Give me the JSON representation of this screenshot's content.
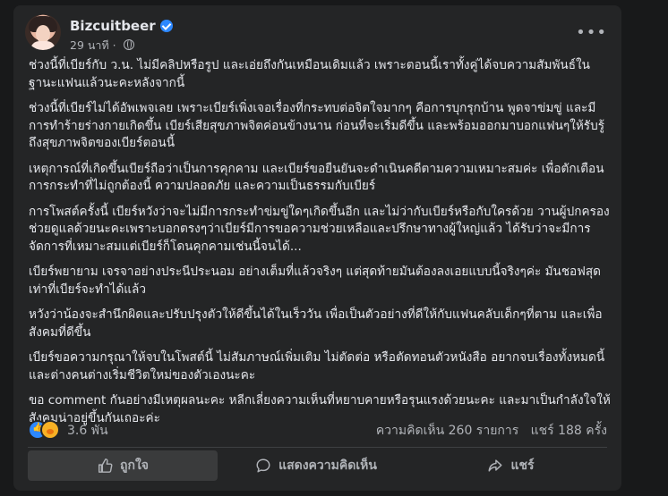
{
  "post": {
    "author": "Bizcuitbeer",
    "time": "29 นาที",
    "paragraphs": [
      "ช่วงนี้ที่เบียร์กับ ว.น. ไม่มีคลิปหรือรูป และเอ่ยถึงกันเหมือนเดิมแล้ว เพราะตอนนี้เราทั้งคู่ได้จบความสัมพันธ์ในฐานะแฟนแล้วนะคะหลังจากนี้",
      "ช่วงนี้ที่เบียร์ไม่ได้อัพเพจเลย เพราะเบียร์เพิ่งเจอเรื่องที่กระทบต่อจิตใจมากๆ คือการบุกรุกบ้าน พูดจาข่มขู่ และมีการทำร้ายร่างกายเกิดขึ้น เบียร์เสียสุขภาพจิตค่อนข้างนาน ก่อนที่จะเริ่มดีขึ้น และพร้อมออกมาบอกแฟนๆให้รับรู้ถึงสุขภาพจิตของเบียร์ตอนนี้",
      "เหตุการณ์ที่เกิดขึ้นเบียร์ถือว่าเป็นการคุกคาม และเบียร์ขอยืนยันจะดำเนินคดีตามความเหมาะสมค่ะ เพื่อตักเตือนการกระทำที่ไม่ถูกต้องนี้ ความปลอดภัย และความเป็นธรรมกับเบียร์",
      "การโพสต์ครั้งนี้ เบียร์หวังว่าจะไม่มีการกระทำข่มขู่ใดๆเกิดขึ้นอีก และไม่ว่ากับเบียร์หรือกับใครด้วย วานผู้ปกครองช่วยดูแลด้วยนะคะเพราะบอกตรงๆว่าเบียร์มีการขอความช่วยเหลือและปรึกษาทางผู้ใหญ่แล้ว ได้รับว่าจะมีการจัดการที่เหมาะสมแต่เบียร์ก็โดนคุกคามเช่นนี้จนได้...",
      "เบียร์พยายาม เจรจาอย่างประนีประนอม อย่างเต็มที่แล้วจริงๆ แต่สุดท้ายมันต้องลงเอยแบบนี้จริงๆค่ะ มันชอฟสุดเท่าที่เบียร์จะทำได้แล้ว",
      "หวังว่าน้องจะสำนึกผิดและปรับปรุงตัวให้ดีขึ้นได้ในเร็ววัน เพื่อเป็นตัวอย่างที่ดีให้กับแฟนคลับเด็กๆที่ตาม และเพื่อสังคมที่ดีขึ้น",
      "เบียร์ขอความกรุณาให้จบในโพสต์นี้ ไม่สัมภาษณ์เพิ่มเติม ไม่ตัดต่อ หรือตัดทอนตัวหนังสือ อยากจบเรื่องทั้งหมดนี้และต่างคนต่างเริ่มชีวิตใหม่ของตัวเองนะคะ",
      "ขอ comment กันอย่างมีเหตุผลนะคะ หลีกเลี่ยงความเห็นที่หยาบคายหรือรุนแรงด้วยนะคะ และมาเป็นกำลังใจให้สังคมน่าอยู่ขึ้นกันเถอะค่ะ"
    ]
  },
  "stats": {
    "reactions": "3.6 พัน",
    "comments": "ความคิดเห็น 260 รายการ",
    "shares": "แชร์ 188 ครั้ง"
  },
  "actions": {
    "like": "ถูกใจ",
    "comment": "แสดงความคิดเห็น",
    "share": "แชร์"
  }
}
